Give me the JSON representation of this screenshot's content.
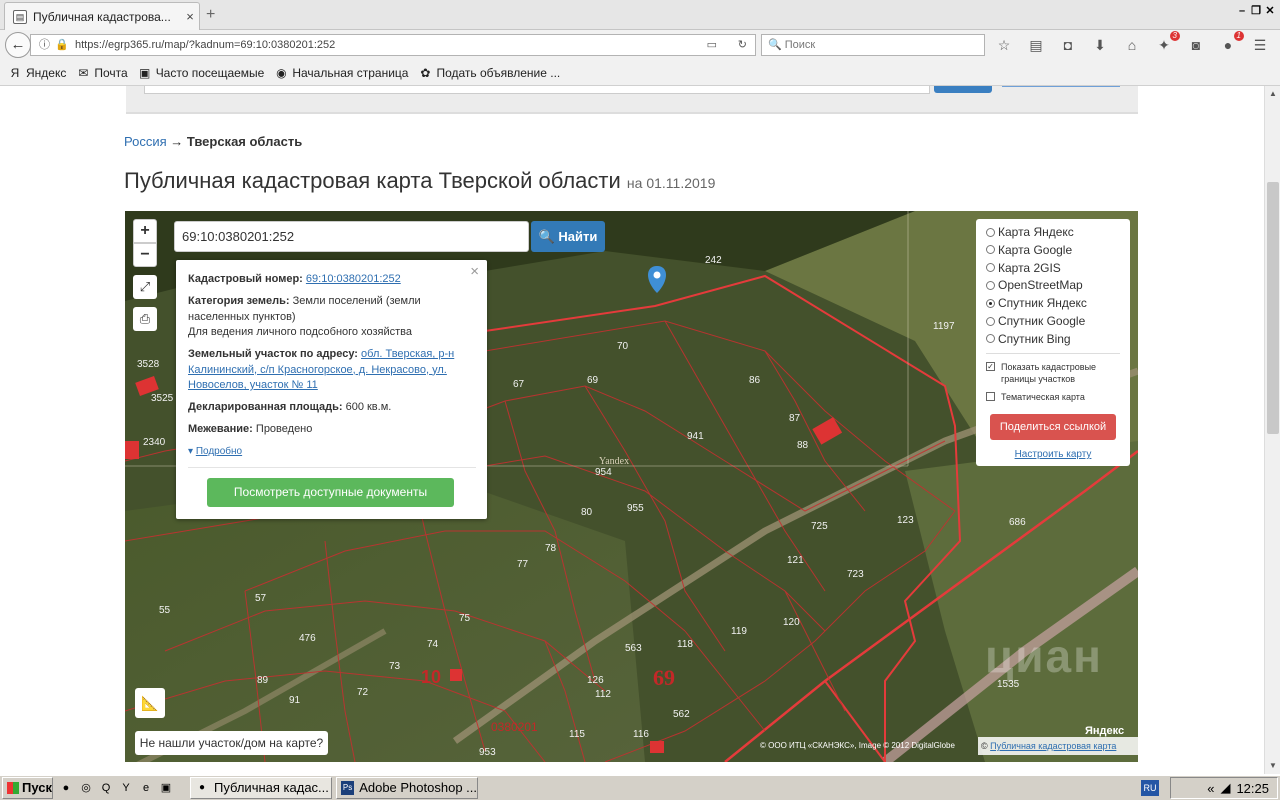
{
  "browser": {
    "tab_title": "Публичная кадастрова...",
    "tab_close": "×",
    "new_tab": "+",
    "url": "https://egrp365.ru/map/?kadnum=69:10:0380201:252",
    "search_placeholder": "Поиск",
    "badge_1": "3",
    "badge_2": "1",
    "bookmarks": [
      {
        "label": "Яндекс",
        "icon": "Я"
      },
      {
        "label": "Почта",
        "icon": "✉"
      },
      {
        "label": "Часто посещаемые",
        "icon": "▣"
      },
      {
        "label": "Начальная страница",
        "icon": "◉"
      },
      {
        "label": "Подать объявление ...",
        "icon": "✿"
      }
    ]
  },
  "breadcrumb": {
    "root": "Россия",
    "arrow": "→",
    "current": "Тверская область"
  },
  "page": {
    "title": "Публичная кадастровая карта Тверской области",
    "date": "на 01.11.2019"
  },
  "map": {
    "zoom_in": "+",
    "zoom_out": "−",
    "search_value": "69:10:0380201:252",
    "find_label": "Найти",
    "popup": {
      "close": "×",
      "cad_label": "Кадастровый номер:",
      "cad_value": "69:10:0380201:252",
      "cat_label": "Категория земель:",
      "cat_value_1": "Земли поселений (земли",
      "cat_value_2": "населенных пунктов)",
      "use_value": "Для ведения личного подсобного хозяйства",
      "addr_label": "Земельный участок по адресу:",
      "addr_value_1": "обл. Тверская, р-н",
      "addr_value_2": "Калининский, с/п Красногорское, д. Некрасово, ул.",
      "addr_value_3": "Новоселов, участок № 11",
      "area_label": "Декларированная площадь:",
      "area_value": "600 кв.м.",
      "survey_label": "Межевание:",
      "survey_value": "Проведено",
      "more": "Подробно",
      "docs_button": "Посмотреть доступные документы"
    },
    "layers": {
      "options": [
        {
          "label": "Карта Яндекс",
          "selected": false
        },
        {
          "label": "Карта Google",
          "selected": false
        },
        {
          "label": "Карта 2GIS",
          "selected": false
        },
        {
          "label": "OpenStreetMap",
          "selected": false
        },
        {
          "label": "Спутник Яндекс",
          "selected": true
        },
        {
          "label": "Спутник Google",
          "selected": false
        },
        {
          "label": "Спутник Bing",
          "selected": false
        }
      ],
      "show_borders_1": "Показать кадастровые",
      "show_borders_2": "границы участков",
      "thematic": "Тематическая карта",
      "share_button": "Поделиться ссылкой",
      "setup_link": "Настроить карту"
    },
    "not_found": "Не нашли участок/дом на карте?",
    "copyright": "© ООО ИТЦ «СКАНЭКС», Image © 2012 DigitalGlobe",
    "pkk_prefix": "©",
    "pkk_link": "Публичная кадастровая карта",
    "yandex_mark": "Яндекс",
    "watermark": "циан",
    "yandex_label": "Yandex",
    "parcel_labels": [
      {
        "t": "242"
      },
      {
        "t": "1197"
      },
      {
        "t": "70"
      },
      {
        "t": "67"
      },
      {
        "t": "69"
      },
      {
        "t": "86"
      },
      {
        "t": "3528"
      },
      {
        "t": "3525"
      },
      {
        "t": "2340"
      },
      {
        "t": "87"
      },
      {
        "t": "88"
      },
      {
        "t": "941"
      },
      {
        "t": "954"
      },
      {
        "t": "955"
      },
      {
        "t": "80"
      },
      {
        "t": "725"
      },
      {
        "t": "121"
      },
      {
        "t": "723"
      },
      {
        "t": "123"
      },
      {
        "t": "686"
      },
      {
        "t": "120"
      },
      {
        "t": "119"
      },
      {
        "t": "118"
      },
      {
        "t": "563"
      },
      {
        "t": "126"
      },
      {
        "t": "112"
      },
      {
        "t": "562"
      },
      {
        "t": "116"
      },
      {
        "t": "115"
      },
      {
        "t": "953"
      },
      {
        "t": "75"
      },
      {
        "t": "74"
      },
      {
        "t": "73"
      },
      {
        "t": "72"
      },
      {
        "t": "89"
      },
      {
        "t": "91"
      },
      {
        "t": "476"
      },
      {
        "t": "55"
      },
      {
        "t": "57"
      },
      {
        "t": "1535"
      },
      {
        "t": "77"
      },
      {
        "t": "78"
      }
    ],
    "big_labels": {
      "block10": "10",
      "block69": "69",
      "quarter": "0380201"
    }
  },
  "taskbar": {
    "start": "Пуск",
    "task1": "Публичная кадас...",
    "task2": "Adobe Photoshop ...",
    "lang": "RU",
    "time": "12:25"
  },
  "colors": {
    "border_red": "#e43b3b",
    "parcel_red": "#c43030",
    "find_blue": "#337ab7",
    "docs_green": "#5cb85c",
    "share_red": "#d9534f"
  }
}
